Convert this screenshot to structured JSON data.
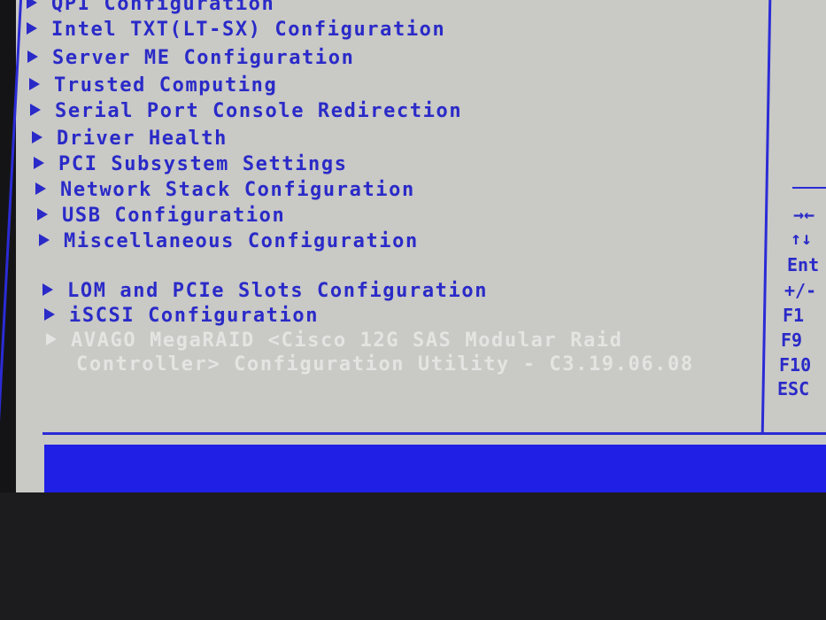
{
  "menu": {
    "items": [
      {
        "label": "QPI Configuration"
      },
      {
        "label": "Intel TXT(LT-SX) Configuration"
      },
      {
        "label": "Server ME Configuration"
      },
      {
        "label": "Trusted Computing"
      },
      {
        "label": "Serial Port Console Redirection"
      },
      {
        "label": "Driver Health"
      },
      {
        "label": "PCI Subsystem Settings"
      },
      {
        "label": "Network Stack Configuration"
      },
      {
        "label": "USB Configuration"
      },
      {
        "label": "Miscellaneous Configuration"
      },
      {
        "label": "LOM and PCIe Slots Configuration"
      },
      {
        "label": "iSCSI Configuration"
      },
      {
        "label": "AVAGO MegaRAID <Cisco 12G SAS Modular Raid",
        "label_line2": "Controller> Configuration Utility - C3.19.06.08",
        "disabled": true
      }
    ]
  },
  "help_keys": [
    "→←",
    "↑↓",
    "Ent",
    "+/-",
    "F1",
    "F9",
    "F10",
    "ESC"
  ],
  "colors": {
    "text": "#2a2ac8",
    "background": "#c9c9c6",
    "accent_bar": "#1f1fe6",
    "disabled_text": "#e4e4e2"
  }
}
